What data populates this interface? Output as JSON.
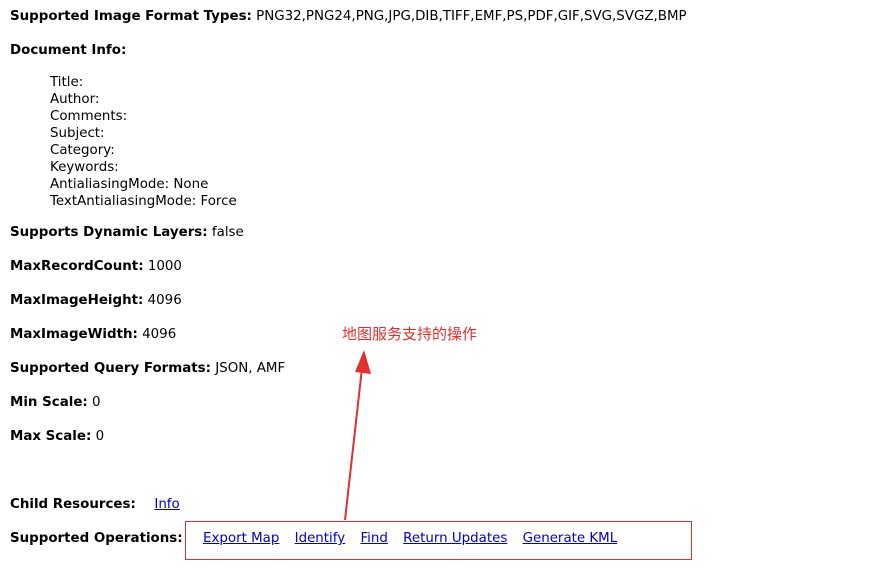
{
  "image_formats": {
    "label": "Supported Image Format Types:",
    "value": " PNG32,PNG24,PNG,JPG,DIB,TIFF,EMF,PS,PDF,GIF,SVG,SVGZ,BMP"
  },
  "document_info": {
    "label": "Document Info:",
    "fields": [
      "Title:",
      "Author:",
      "Comments:",
      "Subject:",
      "Category:",
      "Keywords:",
      "AntialiasingMode: None",
      "TextAntialiasingMode: Force"
    ]
  },
  "dynamic_layers": {
    "label": "Supports Dynamic Layers:",
    "value": " false"
  },
  "max_record_count": {
    "label": "MaxRecordCount:",
    "value": " 1000"
  },
  "max_image_height": {
    "label": "MaxImageHeight:",
    "value": " 4096"
  },
  "max_image_width": {
    "label": "MaxImageWidth:",
    "value": " 4096"
  },
  "query_formats": {
    "label": "Supported Query Formats:",
    "value": " JSON, AMF"
  },
  "min_scale": {
    "label": "Min Scale:",
    "value": " 0"
  },
  "max_scale": {
    "label": "Max Scale:",
    "value": " 0"
  },
  "child_resources": {
    "label": "Child Resources:",
    "link": "Info"
  },
  "operations": {
    "label": "Supported Operations:",
    "links": [
      "Export Map",
      "Identify",
      "Find",
      "Return Updates",
      "Generate KML"
    ]
  },
  "annotation": {
    "text": "地图服务支持的操作",
    "color": "#e03030"
  },
  "colors": {
    "link": "#0000cc",
    "annotation": "#e03030"
  }
}
